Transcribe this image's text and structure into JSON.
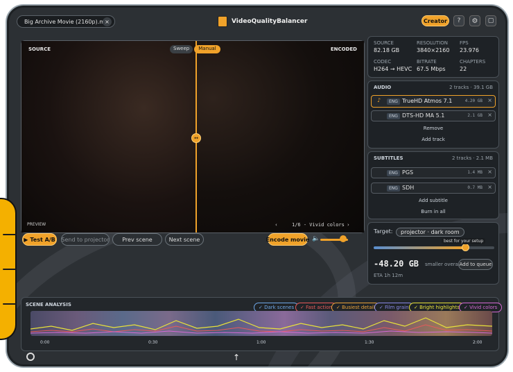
{
  "file": {
    "name": "Big Archive Movie (2160p).mkv"
  },
  "app": {
    "title": "VideoQualityBalancer",
    "mode": "Creator"
  },
  "preview": {
    "source_label": "SOURCE",
    "encoded_label": "ENCODED",
    "sweep_label": "Sweep",
    "manual_label": "Manual",
    "preview_label": "PREVIEW",
    "scene_counter": "1/6 - Vivid colors",
    "split_position": 0.5
  },
  "actions": {
    "test": "Test A/B",
    "send": "Send to projector",
    "prev": "Prev scene",
    "next": "Next scene",
    "encode": "Encode movie"
  },
  "specs": [
    {
      "label": "SOURCE",
      "value": "82.18 GB"
    },
    {
      "label": "RESOLUTION",
      "value": "3840×2160"
    },
    {
      "label": "FPS",
      "value": "23.976"
    },
    {
      "label": "CODEC",
      "value": "H264 → HEVC"
    },
    {
      "label": "BITRATE",
      "value": "67.5 Mbps"
    },
    {
      "label": "CHAPTERS",
      "value": "22"
    }
  ],
  "audio": {
    "header": "AUDIO",
    "info": "2 tracks · 39.1 GB",
    "tracks": [
      {
        "lang": "ENG",
        "name": "TrueHD Atmos 7.1",
        "size": "4.20 GB"
      },
      {
        "lang": "ENG",
        "name": "DTS-HD MA 5.1",
        "size": "2.1 GB"
      }
    ],
    "buttons": [
      "Remove",
      "Add track"
    ]
  },
  "subs": {
    "header": "SUBTITLES",
    "info": "2 tracks · 2.1 MB",
    "tracks": [
      {
        "lang": "ENG",
        "name": "PGS",
        "size": "1.4 MB"
      },
      {
        "lang": "ENG",
        "name": "SDH",
        "size": "0.7 MB"
      }
    ],
    "buttons": [
      "Add subtitle",
      "Burn in all"
    ]
  },
  "target": {
    "label": "Target:",
    "profile": "projector · dark room",
    "tip": "best for your setup",
    "slider_value": 0.76,
    "saving": "-48.20 GB",
    "saving_label": "smaller overall",
    "eta_label": "ETA 1h 12m",
    "queue": "Add to queue"
  },
  "timeline": {
    "title": "SCENE ANALYSIS",
    "times": [
      "0:00",
      "0:30",
      "1:00",
      "1:30",
      "2:00"
    ],
    "chips": [
      {
        "label": "✓ Dark scenes",
        "color": "#6fa8e8"
      },
      {
        "label": "✓ Fast action",
        "color": "#e85a5a"
      },
      {
        "label": "✓ Busiest detail",
        "color": "#e8a23a"
      },
      {
        "label": "✓ Film grain",
        "color": "#8a8ae8"
      },
      {
        "label": "✓ Bright highlights",
        "color": "#e8e23a"
      },
      {
        "label": "✓ Vivid colors",
        "color": "#d66ad6"
      }
    ]
  },
  "colors": {
    "accent": "#f0a22a",
    "panel": "#1e2226"
  }
}
